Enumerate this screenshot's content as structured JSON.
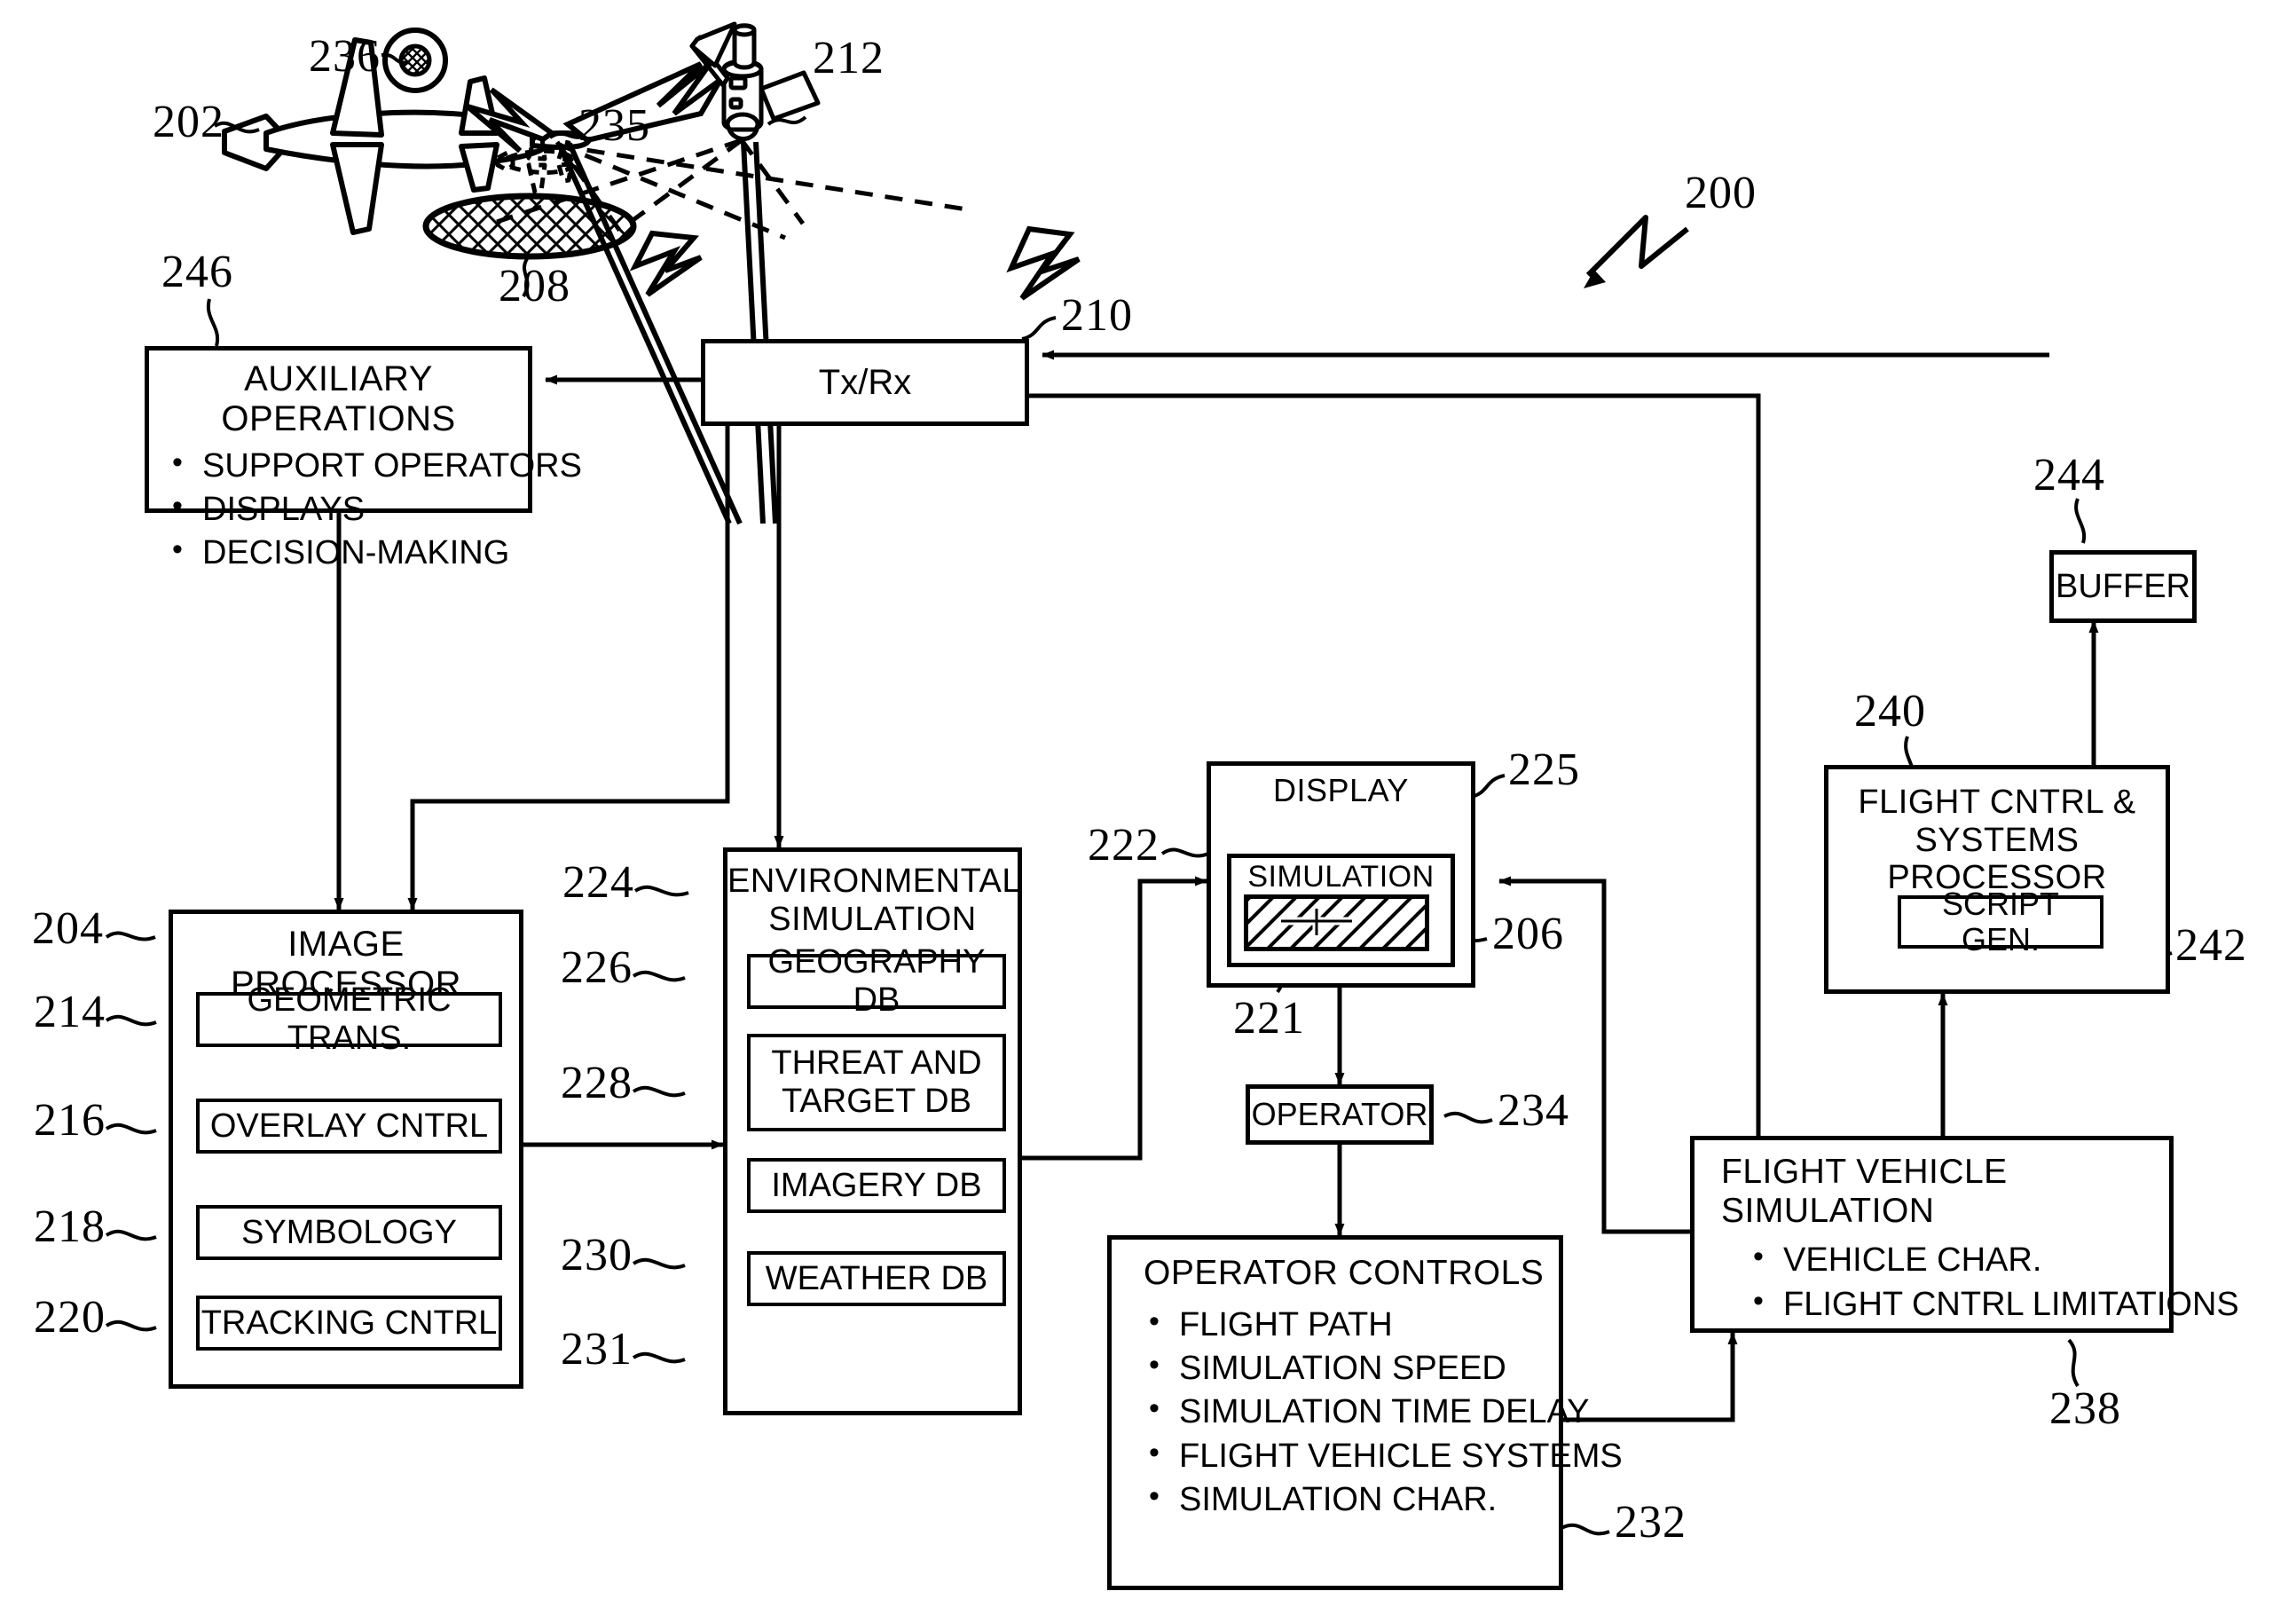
{
  "figure": {
    "number": "200",
    "title_ref": "200"
  },
  "scene": {
    "aircraft_ref": "202",
    "sensor_ref": "236",
    "satellite_ref": "212",
    "ghost_aircraft_ref": "235",
    "ground_target_ref": "208",
    "system_arrow_ref": "200"
  },
  "blocks": {
    "auxiliary_operations": {
      "ref": "246",
      "title": "AUXILIARY OPERATIONS",
      "items": [
        "SUPPORT OPERATORS",
        "DISPLAYS",
        "DECISION-MAKING"
      ]
    },
    "txrx": {
      "ref": "210",
      "title": "Tx/Rx"
    },
    "image_processor": {
      "ref": "204",
      "title": "IMAGE PROCESSOR",
      "modules": [
        {
          "ref": "214",
          "label": "GEOMETRIC TRANS."
        },
        {
          "ref": "216",
          "label": "OVERLAY CNTRL"
        },
        {
          "ref": "218",
          "label": "SYMBOLOGY"
        },
        {
          "ref": "220",
          "label": "TRACKING CNTRL"
        }
      ]
    },
    "environmental_simulation": {
      "ref": "224",
      "title": "ENVIRONMENTAL\nSIMULATION",
      "databases": [
        {
          "ref": "226",
          "label": "GEOGRAPHY DB"
        },
        {
          "ref": "228",
          "label": "THREAT AND\nTARGET DB"
        },
        {
          "ref": "230",
          "label": "IMAGERY DB"
        },
        {
          "ref": "231",
          "label": "WEATHER DB"
        }
      ]
    },
    "display": {
      "ref": "225",
      "title": "DISPLAY",
      "simulation": {
        "ref": "222",
        "title": "SIMULATION",
        "image_ref": "206",
        "target_ref": "221"
      }
    },
    "operator": {
      "ref": "234",
      "title": "OPERATOR"
    },
    "operator_controls": {
      "ref": "232",
      "title": "OPERATOR CONTROLS",
      "items": [
        "FLIGHT PATH",
        "SIMULATION SPEED",
        "SIMULATION TIME DELAY",
        "FLIGHT VEHICLE SYSTEMS",
        "SIMULATION CHAR."
      ]
    },
    "flight_vehicle_simulation": {
      "ref": "238",
      "title": "FLIGHT VEHICLE SIMULATION",
      "items": [
        "VEHICLE CHAR.",
        "FLIGHT CNTRL LIMITATIONS"
      ]
    },
    "flight_control_processor": {
      "ref": "240",
      "title": "FLIGHT CNTRL &\nSYSTEMS PROCESSOR",
      "script_gen": {
        "ref": "242",
        "label": "SCRIPT GEN."
      }
    },
    "buffer": {
      "ref": "244",
      "title": "BUFFER"
    }
  },
  "colors": {
    "ink": "#000000",
    "paper": "#ffffff"
  }
}
